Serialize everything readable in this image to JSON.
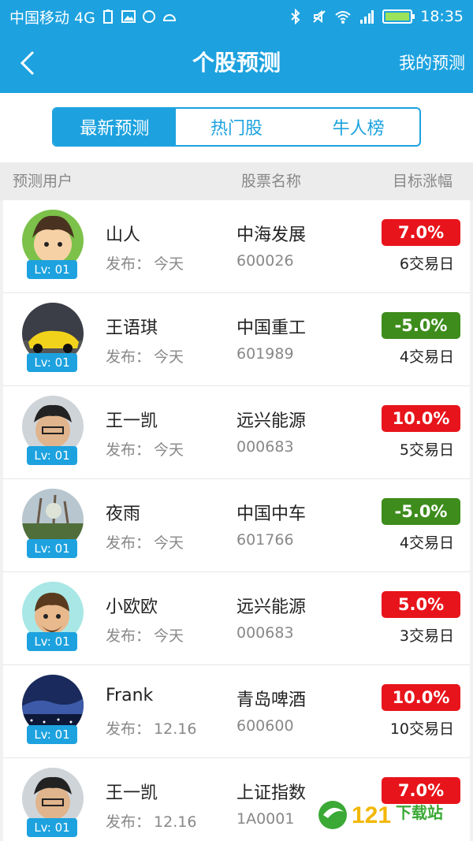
{
  "status_bar": {
    "carrier": "中国移动 4G",
    "time": "18:35",
    "signal_label": "4G"
  },
  "header": {
    "title": "个股预测",
    "right_action": "我的预测"
  },
  "tabs": [
    {
      "label": "最新预测",
      "active": true
    },
    {
      "label": "热门股",
      "active": false
    },
    {
      "label": "牛人榜",
      "active": false
    }
  ],
  "columns": {
    "user": "预测用户",
    "stock": "股票名称",
    "target": "目标涨幅"
  },
  "colors": {
    "primary": "#1da2df",
    "up": "#e8141b",
    "down": "#3e8c1b"
  },
  "rows": [
    {
      "user": "山人",
      "pub_label": "发布：",
      "pub_date": "今天",
      "level": "Lv: 01",
      "stock": "中海发展",
      "code": "600026",
      "target": "7.0%",
      "direction": "up",
      "days": "6交易日"
    },
    {
      "user": "王语琪",
      "pub_label": "发布：",
      "pub_date": "今天",
      "level": "Lv: 01",
      "stock": "中国重工",
      "code": "601989",
      "target": "-5.0%",
      "direction": "down",
      "days": "4交易日"
    },
    {
      "user": "王一凯",
      "pub_label": "发布：",
      "pub_date": "今天",
      "level": "Lv: 01",
      "stock": "远兴能源",
      "code": "000683",
      "target": "10.0%",
      "direction": "up",
      "days": "5交易日"
    },
    {
      "user": "夜雨",
      "pub_label": "发布：",
      "pub_date": "今天",
      "level": "Lv: 01",
      "stock": "中国中车",
      "code": "601766",
      "target": "-5.0%",
      "direction": "down",
      "days": "4交易日"
    },
    {
      "user": "小欧欧",
      "pub_label": "发布：",
      "pub_date": "今天",
      "level": "Lv: 01",
      "stock": "远兴能源",
      "code": "000683",
      "target": "5.0%",
      "direction": "up",
      "days": "3交易日"
    },
    {
      "user": "Frank",
      "pub_label": "发布：",
      "pub_date": "12.16",
      "level": "Lv: 01",
      "stock": "青岛啤酒",
      "code": "600600",
      "target": "10.0%",
      "direction": "up",
      "days": "10交易日"
    },
    {
      "user": "王一凯",
      "pub_label": "发布：",
      "pub_date": "12.16",
      "level": "Lv: 01",
      "stock": "上证指数",
      "code": "1A0001",
      "target": "7.0%",
      "direction": "up",
      "days": ""
    }
  ],
  "watermark": "121下载站"
}
